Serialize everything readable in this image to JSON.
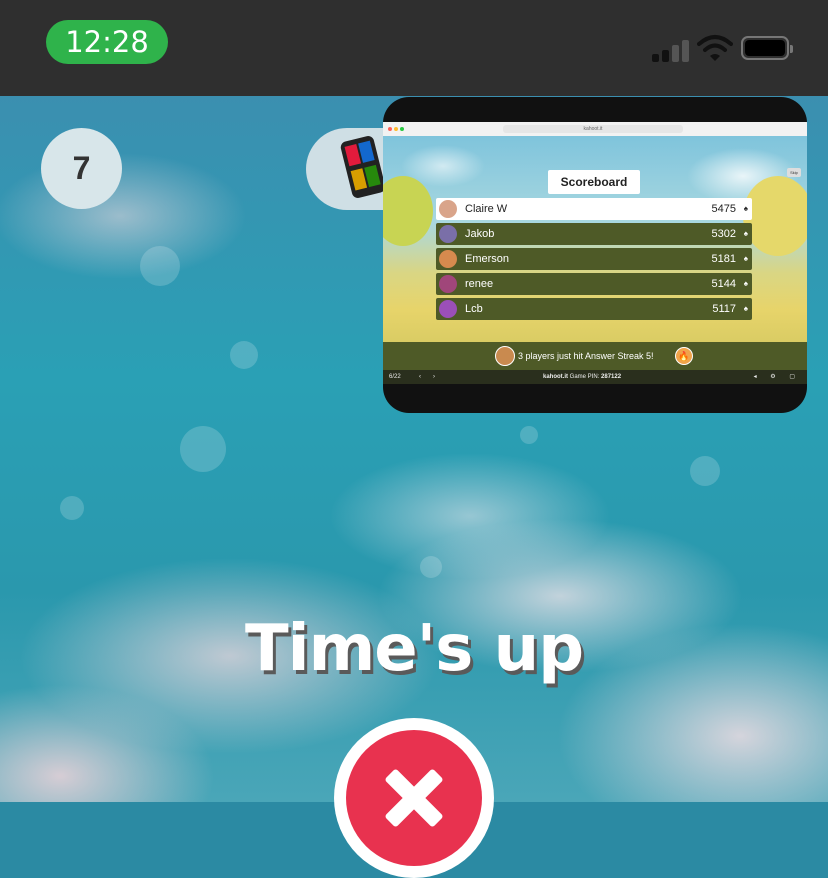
{
  "status_bar": {
    "time": "12:28",
    "icons": [
      "cellular-signal-icon",
      "wifi-icon",
      "battery-icon"
    ]
  },
  "game": {
    "question_number": "7",
    "result_text": "Time's up",
    "result_icon": "wrong-x-icon",
    "colors": {
      "wrong": "#e8324f",
      "pill": "#2fb34b"
    }
  },
  "pip": {
    "browser_url": "kahoot.it",
    "title": "Scoreboard",
    "mini_button": "Skip",
    "rows": [
      {
        "name": "Claire W",
        "score": "5475"
      },
      {
        "name": "Jakob",
        "score": "5302"
      },
      {
        "name": "Emerson",
        "score": "5181"
      },
      {
        "name": "renee",
        "score": "5144"
      },
      {
        "name": "Lcb",
        "score": "5117"
      }
    ],
    "streak_text": "3 players just hit Answer Streak 5!",
    "footer": {
      "counter": "6/22",
      "site": "kahoot.it",
      "pin_label": "Game PIN:",
      "pin": "287122"
    }
  }
}
